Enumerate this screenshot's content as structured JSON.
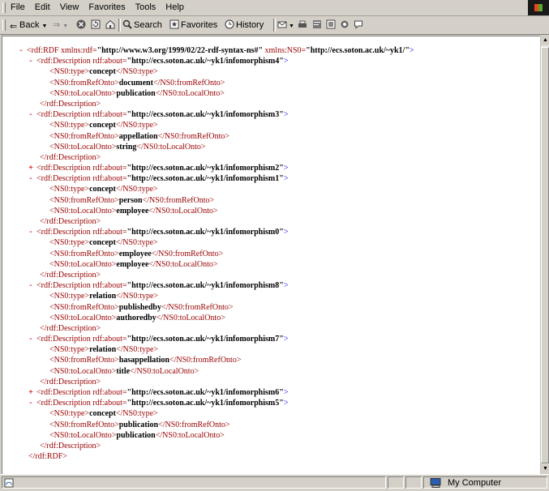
{
  "menu": [
    "File",
    "Edit",
    "View",
    "Favorites",
    "Tools",
    "Help"
  ],
  "toolbar": {
    "back": "Back",
    "search": "Search",
    "favorites": "Favorites",
    "history": "History"
  },
  "xml": {
    "root_open_prefix": "<rdf:RDF xmlns:rdf=",
    "root_ns_rdf": "\"http://www.w3.org/1999/02/22-rdf-syntax-ns#\"",
    "root_ns_label": " xmlns:NS0=",
    "root_ns_ns0": "\"http://ecs.soton.ac.uk/~yk1/\"",
    "root_close": "</rdf:RDF>",
    "descriptions": [
      {
        "toggle": "-",
        "about": "\"http://ecs.soton.ac.uk/~yk1/infomorphism4\"",
        "type": "concept",
        "from": "document",
        "to": "publication"
      },
      {
        "toggle": "-",
        "about": "\"http://ecs.soton.ac.uk/~yk1/infomorphism3\"",
        "type": "concept",
        "from": "appellation",
        "to": "string"
      },
      {
        "toggle": "+",
        "about": "\"http://ecs.soton.ac.uk/~yk1/infomorphism2\""
      },
      {
        "toggle": "-",
        "about": "\"http://ecs.soton.ac.uk/~yk1/infomorphism1\"",
        "type": "concept",
        "from": "person",
        "to": "employee"
      },
      {
        "toggle": "-",
        "about": "\"http://ecs.soton.ac.uk/~yk1/infomorphism0\"",
        "type": "concept",
        "from": "employee",
        "to": "employee"
      },
      {
        "toggle": "-",
        "about": "\"http://ecs.soton.ac.uk/~yk1/infomorphism8\"",
        "type": "relation",
        "from": "publishedby",
        "to": "authoredby"
      },
      {
        "toggle": "-",
        "about": "\"http://ecs.soton.ac.uk/~yk1/infomorphism7\"",
        "type": "relation",
        "from": "hasappellation",
        "to": "title"
      },
      {
        "toggle": "+",
        "about": "\"http://ecs.soton.ac.uk/~yk1/infomorphism6\""
      },
      {
        "toggle": "-",
        "about": "\"http://ecs.soton.ac.uk/~yk1/infomorphism5\"",
        "type": "concept",
        "from": "publication",
        "to": "publication"
      }
    ],
    "tags": {
      "desc_open": "<rdf:Description rdf:about=",
      "desc_close": "</rdf:Description>",
      "type_open": "<NS0:type>",
      "type_close": "</NS0:type>",
      "from_open": "<NS0:fromRefOnto>",
      "from_close": "</NS0:fromRefOnto>",
      "to_open": "<NS0:toLocalOnto>",
      "to_close": "</NS0:toLocalOnto>",
      "gt": ">"
    }
  },
  "status": {
    "zone": "My Computer"
  }
}
